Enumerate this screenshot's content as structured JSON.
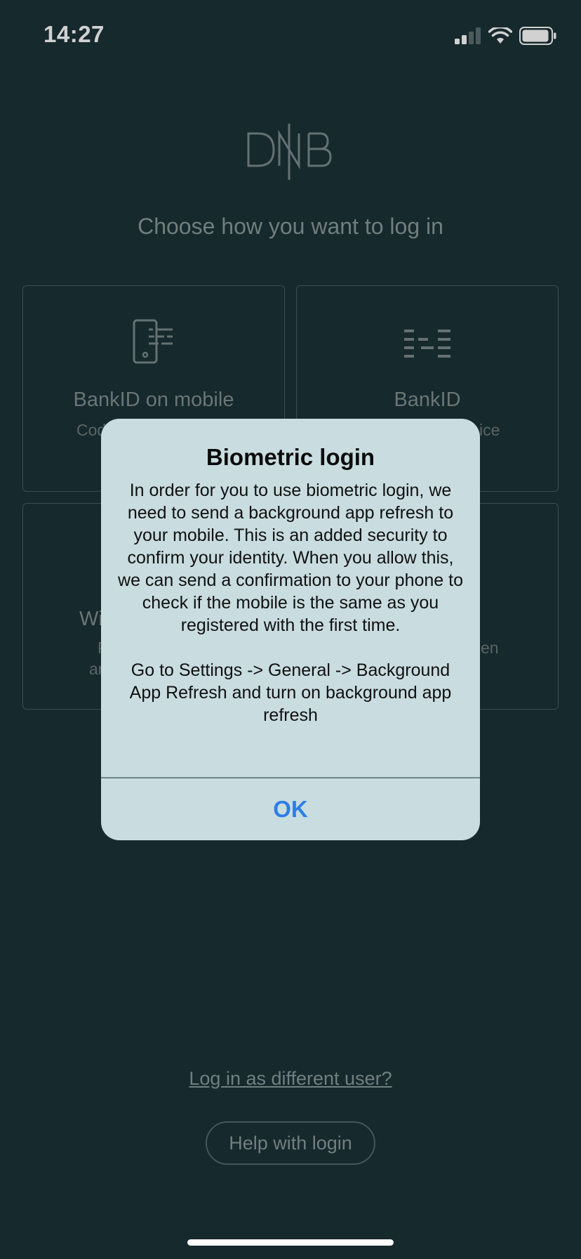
{
  "status_bar": {
    "time": "14:27",
    "icons": [
      "cellular-signal-icon",
      "wifi-icon",
      "battery-icon"
    ]
  },
  "logo": {
    "text": "DNB"
  },
  "subtitle": "Choose how you want to log in",
  "cards": [
    {
      "title": "BankID on mobile",
      "subtitle": "Cod",
      "icon": "phone-code-icon"
    },
    {
      "title": "BankID",
      "subtitle": "ice",
      "icon": "code-device-icon"
    },
    {
      "title": "Wi",
      "subtitle_lines": [
        "P",
        "ar"
      ]
    },
    {
      "subtitle": "en"
    }
  ],
  "links": {
    "different_user": "Log in as different user?",
    "help": "Help with login"
  },
  "alert": {
    "title": "Biometric login",
    "message": "In order for you to use biometric login, we need to send a background app refresh to your mobile. This is an added security to confirm your identity. When you allow this, we can send a confirmation to your phone to check if the mobile is the same as you registered with the first time.\n\nGo to Settings -> General -> Background App Refresh and turn on background app refresh",
    "ok_label": "OK"
  },
  "colors": {
    "background": "#1b3236",
    "alert_background": "#c9dde0",
    "alert_button": "#2f7ee8"
  }
}
